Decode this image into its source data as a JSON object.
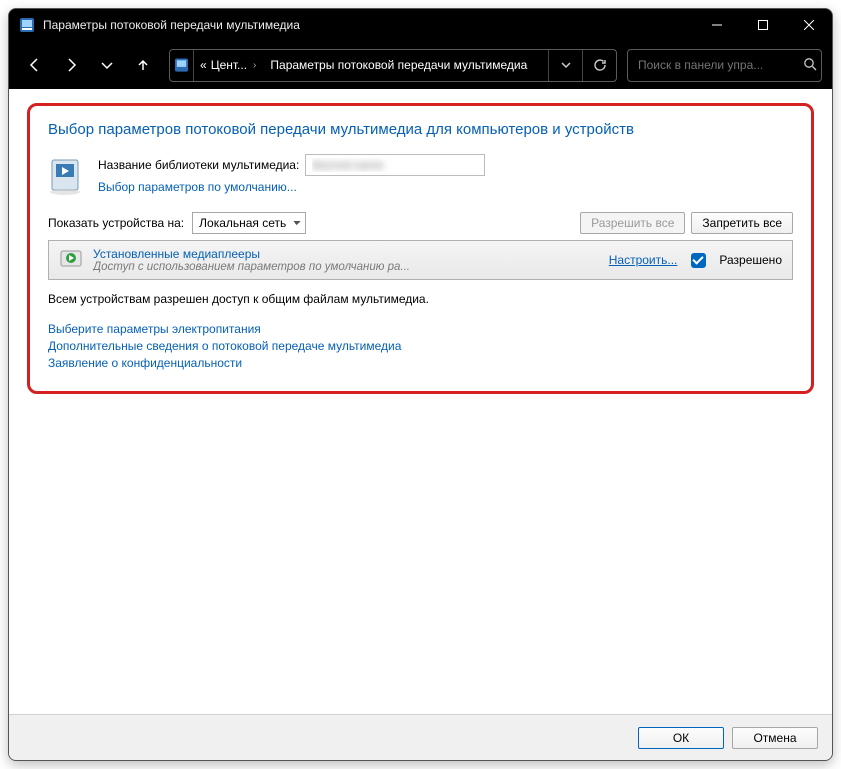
{
  "window": {
    "title": "Параметры потоковой передачи мультимедиа"
  },
  "address": {
    "prefix": "«",
    "seg1": "Цент...",
    "seg2": "Параметры потоковой передачи мультимедиа"
  },
  "search": {
    "placeholder": "Поиск в панели упра..."
  },
  "panel": {
    "heading": "Выбор параметров потоковой передачи мультимедиа для компьютеров и устройств",
    "lib_label": "Название библиотеки мультимедиа:",
    "lib_value": "blurred-name",
    "default_link": "Выбор параметров по умолчанию...",
    "show_on_label": "Показать устройства на:",
    "network_option": "Локальная сеть",
    "allow_all": "Разрешить все",
    "deny_all": "Запретить все",
    "device": {
      "title": "Установленные медиаплееры",
      "subtitle": "Доступ с использованием параметров по умолчанию ра...",
      "configure": "Настроить...",
      "allowed_label": "Разрешено"
    },
    "status": "Всем устройствам разрешен доступ к общим файлам мультимедиа.",
    "links": {
      "power": "Выберите параметры электропитания",
      "more": "Дополнительные сведения о потоковой передаче мультимедиа",
      "privacy": "Заявление о конфиденциальности"
    }
  },
  "footer": {
    "ok": "ОК",
    "cancel": "Отмена"
  }
}
